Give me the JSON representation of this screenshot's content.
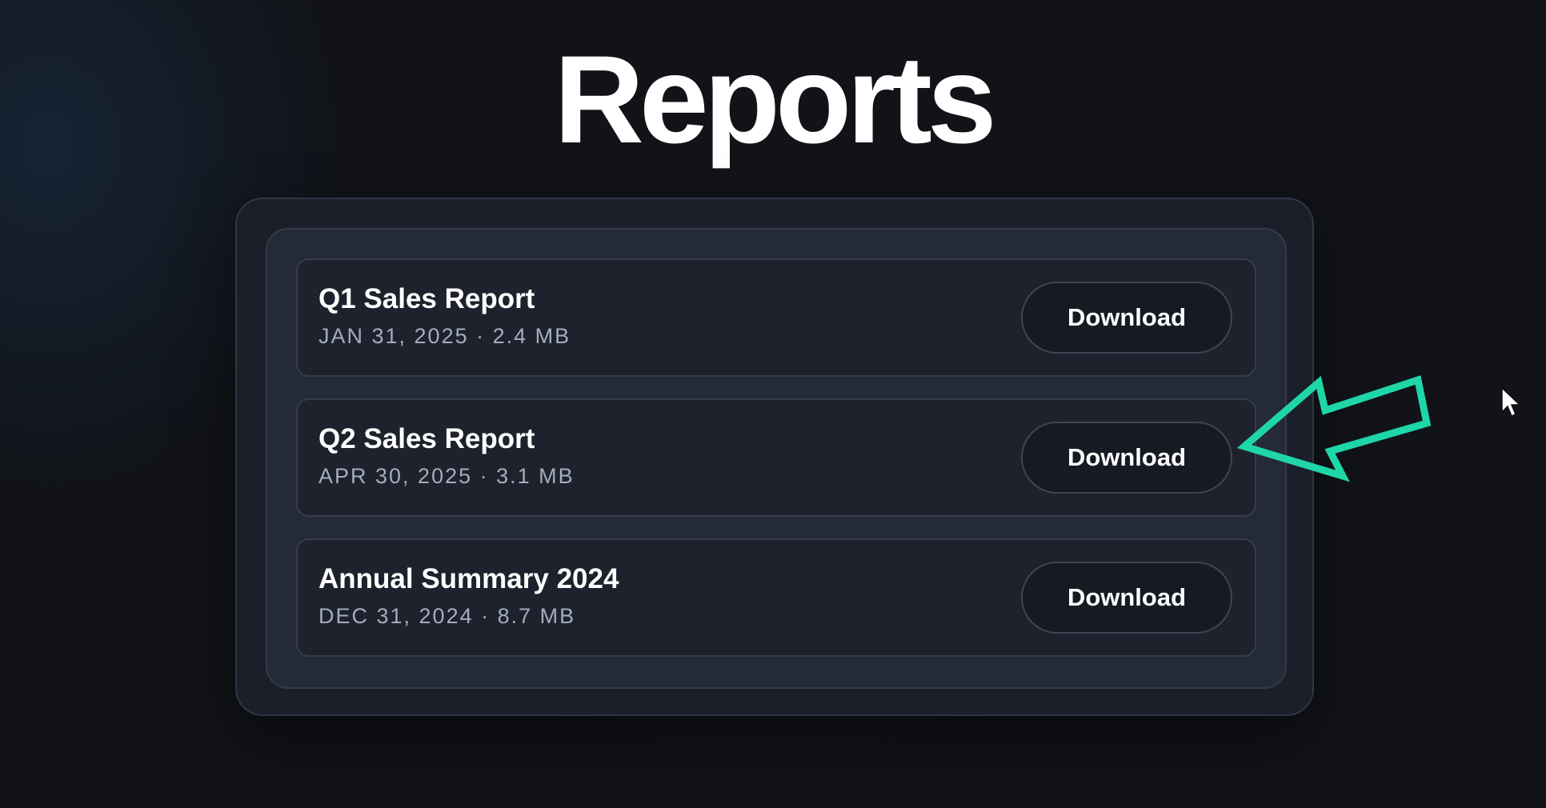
{
  "page": {
    "title": "Reports"
  },
  "reports": [
    {
      "title": "Q1 Sales Report",
      "meta": "JAN 31, 2025 · 2.4 MB",
      "action_label": "Download"
    },
    {
      "title": "Q2 Sales Report",
      "meta": "APR 30, 2025 · 3.1 MB",
      "action_label": "Download"
    },
    {
      "title": "Annual Summary 2024",
      "meta": "DEC 31, 2024 · 8.7 MB",
      "action_label": "Download"
    }
  ],
  "annotation": {
    "icon": "arrow-pointer-icon",
    "color": "#1fd6a8"
  },
  "cursor": {
    "icon": "mouse-cursor-icon",
    "color": "#ffffff"
  },
  "theme": {
    "background": "#111318",
    "card": "#1b1f29",
    "row": "#1d222c",
    "button": "#161a22",
    "text": "#ffffff",
    "muted_text": "#a4adbd"
  }
}
